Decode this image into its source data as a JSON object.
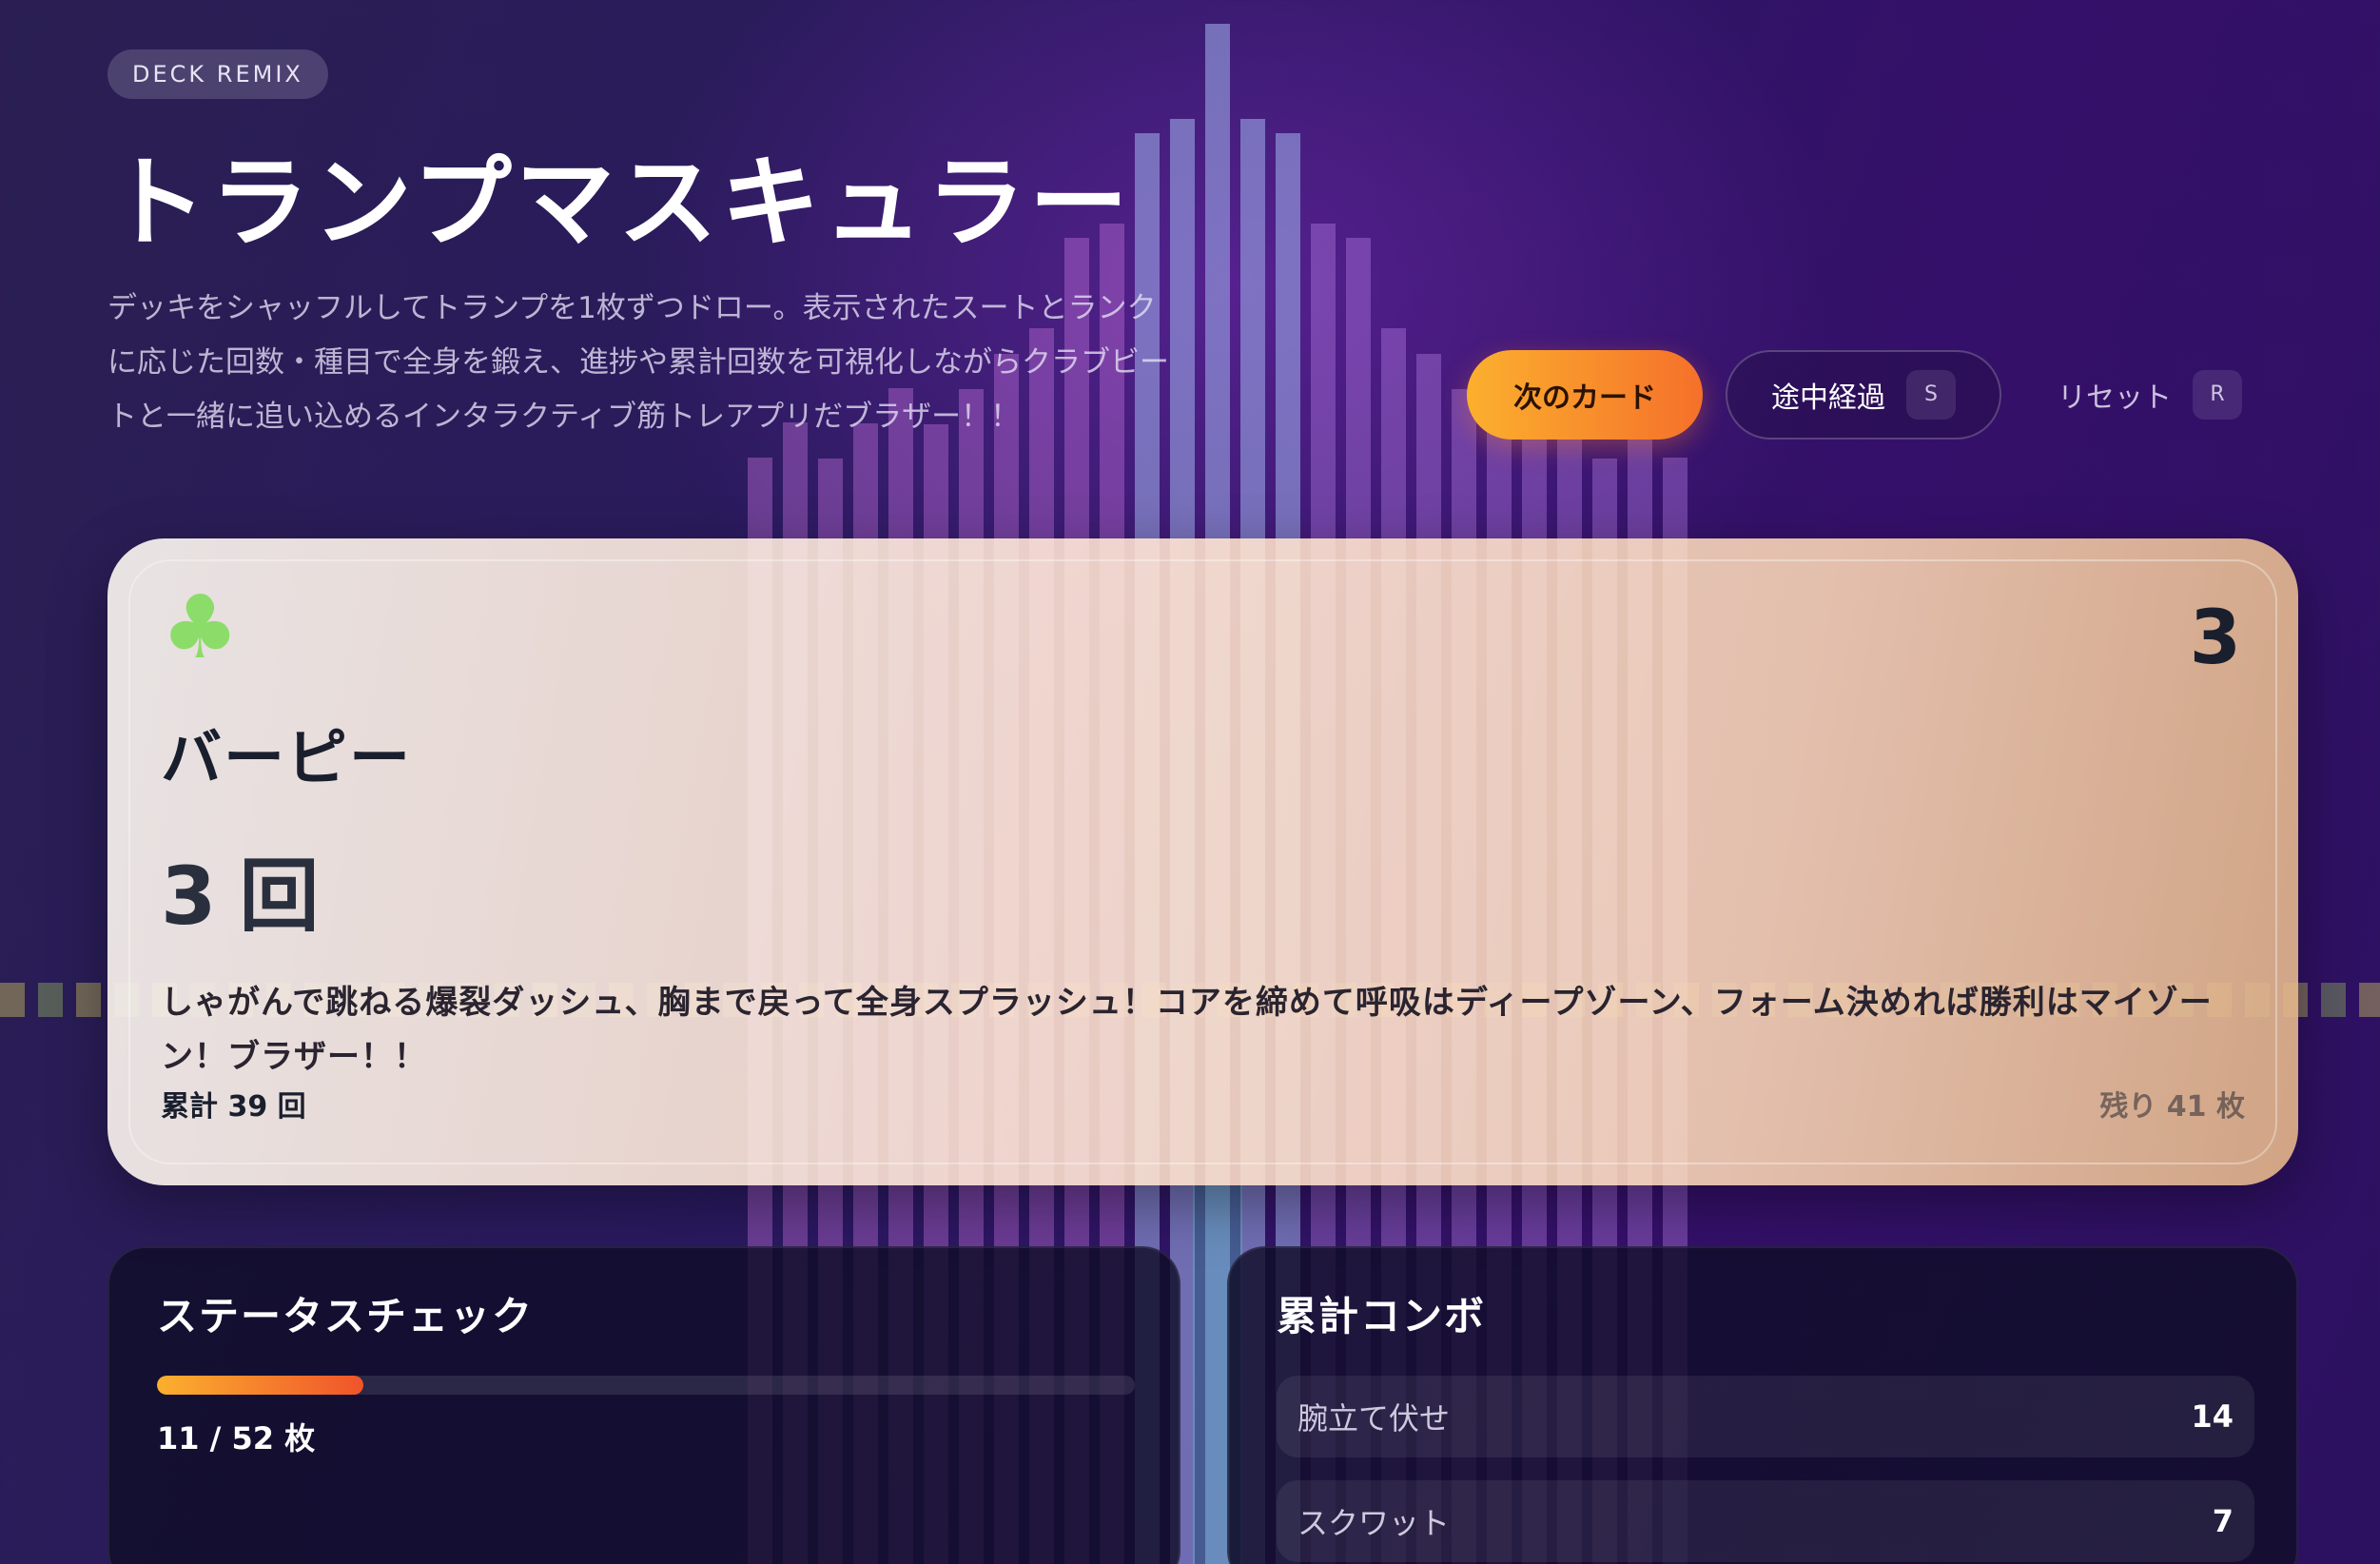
{
  "header": {
    "badge": "DECK REMIX",
    "title": "トランプマスキュラー",
    "description": "デッキをシャッフルしてトランプを1枚ずつドロー。表示されたスートとランクに応じた回数・種目で全身を鍛え、進捗や累計回数を可視化しながらクラブビートと一緒に追い込めるインタラクティブ筋トレアプリだブラザー！！"
  },
  "actions": {
    "next_label": "次のカード",
    "progress_label": "途中経過",
    "progress_key": "S",
    "reset_label": "リセット",
    "reset_key": "R"
  },
  "card": {
    "suit_symbol": "♣",
    "suit_icon": "club-icon",
    "suit_color": "#8cdc6a",
    "rank": "3",
    "exercise": "バーピー",
    "reps": "3",
    "reps_unit": "回",
    "cheer": "しゃがんで跳ねる爆裂ダッシュ、胸まで戻って全身スプラッシュ！コアを締めて呼吸はディープゾーン、フォーム決めれば勝利はマイゾーン！ブラザー！！",
    "total": "累計 39 回",
    "remaining": "残り 41 枚"
  },
  "status": {
    "title": "ステータスチェック",
    "progress_fraction": 0.2115,
    "progress_text": "11 / 52 枚"
  },
  "combo": {
    "title": "累計コンボ",
    "items": [
      {
        "name": "腕立て伏せ",
        "count": "14"
      },
      {
        "name": "スクワット",
        "count": "7"
      }
    ]
  },
  "colors": {
    "accent_start": "#fbb02e",
    "accent_end": "#f5702a",
    "background": "#2a1960"
  }
}
